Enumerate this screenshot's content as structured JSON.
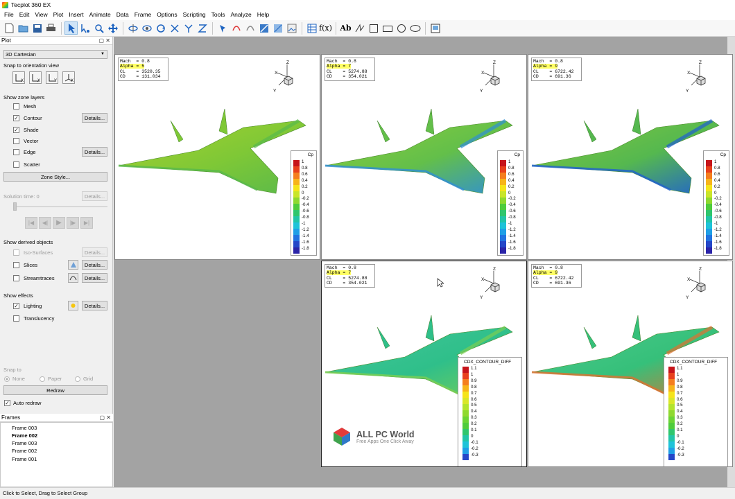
{
  "app": {
    "title": "Tecplot 360 EX"
  },
  "menu": [
    "File",
    "Edit",
    "View",
    "Plot",
    "Insert",
    "Animate",
    "Data",
    "Frame",
    "Options",
    "Scripting",
    "Tools",
    "Analyze",
    "Help"
  ],
  "plot_panel": {
    "title": "Plot",
    "plot_type": "3D Cartesian",
    "snap_orientation_label": "Snap to orientation view",
    "orient_buttons": [
      "X",
      "X",
      "Y",
      "X"
    ],
    "zone_layers_label": "Show zone layers",
    "layers": [
      {
        "label": "Mesh",
        "checked": false,
        "details": false
      },
      {
        "label": "Contour",
        "checked": true,
        "details": true
      },
      {
        "label": "Shade",
        "checked": true,
        "details": false
      },
      {
        "label": "Vector",
        "checked": false,
        "details": false
      },
      {
        "label": "Edge",
        "checked": false,
        "details": true
      },
      {
        "label": "Scatter",
        "checked": false,
        "details": false
      }
    ],
    "details_label": "Details...",
    "zone_style_label": "Zone Style...",
    "solution_time_label": "Solution time:",
    "solution_time_value": "0",
    "derived_label": "Show derived objects",
    "derived": [
      {
        "label": "Iso-Surfaces",
        "checked": false,
        "enabled": false
      },
      {
        "label": "Slices",
        "checked": false,
        "enabled": true
      },
      {
        "label": "Streamtraces",
        "checked": false,
        "enabled": true
      }
    ],
    "effects_label": "Show effects",
    "effects": [
      {
        "label": "Lighting",
        "checked": true
      },
      {
        "label": "Translucency",
        "checked": false
      }
    ],
    "snap_to_label": "Snap to",
    "snap_options": [
      "None",
      "Paper",
      "Grid"
    ],
    "redraw_label": "Redraw",
    "auto_redraw_label": "Auto redraw",
    "auto_redraw": true
  },
  "frames_panel": {
    "title": "Frames",
    "items": [
      {
        "label": "Frame 003",
        "bold": false
      },
      {
        "label": "Frame 002",
        "bold": true
      },
      {
        "label": "Frame 003",
        "bold": false
      },
      {
        "label": "Frame 002",
        "bold": false
      },
      {
        "label": "Frame 001",
        "bold": false
      }
    ]
  },
  "plot_frames": [
    {
      "mach": "0.8",
      "alpha": "5",
      "cl": "3520.35",
      "cd": "131.034",
      "legend_title": "Cp",
      "ticks": [
        "1",
        "0.8",
        "0.6",
        "0.4",
        "0.2",
        "0",
        "-0.2",
        "-0.4",
        "-0.6",
        "-0.8",
        "-1",
        "-1.2",
        "-1.4",
        "-1.6",
        "-1.8"
      ],
      "style": "cp5"
    },
    {
      "mach": "0.8",
      "alpha": "7",
      "cl": "5274.88",
      "cd": "354.021",
      "legend_title": "Cp",
      "ticks": [
        "1",
        "0.8",
        "0.6",
        "0.4",
        "0.2",
        "0",
        "-0.2",
        "-0.4",
        "-0.6",
        "-0.8",
        "-1",
        "-1.2",
        "-1.4",
        "-1.6",
        "-1.8"
      ],
      "style": "cp7"
    },
    {
      "mach": "0.8",
      "alpha": "9",
      "cl": "6722.42",
      "cd": "691.36",
      "legend_title": "Cp",
      "ticks": [
        "1",
        "0.8",
        "0.6",
        "0.4",
        "0.2",
        "0",
        "-0.2",
        "-0.4",
        "-0.6",
        "-0.8",
        "-1",
        "-1.2",
        "-1.4",
        "-1.6",
        "-1.8"
      ],
      "style": "cp9"
    },
    {
      "mach": "0.8",
      "alpha": "7",
      "cl": "5274.88",
      "cd": "354.021",
      "legend_title": "CDX_CONTOUR_DIFF",
      "ticks": [
        "1.1",
        "1",
        "0.9",
        "0.8",
        "0.7",
        "0.6",
        "0.5",
        "0.4",
        "0.3",
        "0.2",
        "0.1",
        "0",
        "-0.1",
        "-0.2",
        "-0.3"
      ],
      "style": "diff7"
    },
    {
      "mach": "0.8",
      "alpha": "9",
      "cl": "6722.42",
      "cd": "691.36",
      "legend_title": "CDX_CONTOUR_DIFF",
      "ticks": [
        "1.1",
        "1",
        "0.9",
        "0.8",
        "0.7",
        "0.6",
        "0.5",
        "0.4",
        "0.3",
        "0.2",
        "0.1",
        "0",
        "-0.1",
        "-0.2",
        "-0.3"
      ],
      "style": "diff9"
    }
  ],
  "info_labels": {
    "mach": "Mach",
    "alpha": "Alpha",
    "cl": "CL",
    "cd": "CD"
  },
  "axis_labels": {
    "x": "X",
    "y": "Y",
    "z": "Z"
  },
  "watermark": {
    "title": "ALL PC World",
    "subtitle": "Free Apps One Click Away"
  },
  "status": "Click to Select, Drag to Select Group"
}
